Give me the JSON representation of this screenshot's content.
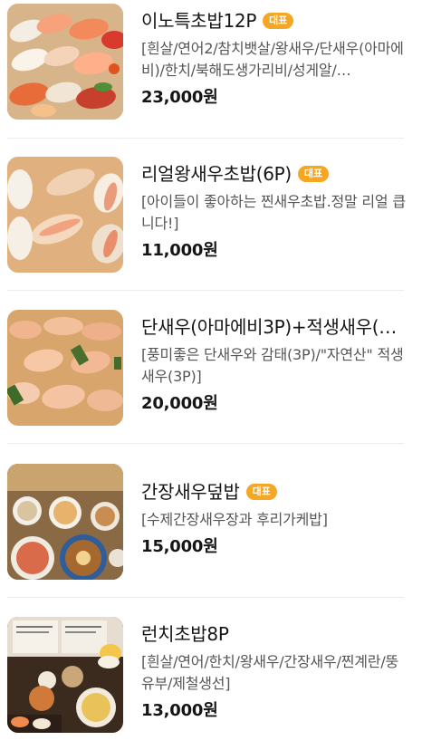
{
  "menu": {
    "items": [
      {
        "name": "이노특초밥12P",
        "badge": "대표",
        "description": "[흰살/연어2/참치뱃살/왕새우/단새우(아마에비)/한치/북해도생가리비/성게알/…",
        "price": "23,000원"
      },
      {
        "name": "리얼왕새우초밥(6P)",
        "badge": "대표",
        "description": "[아이들이 좋아하는 찐새우초밥.정말 리얼 큽니다!]",
        "price": "11,000원"
      },
      {
        "name": "단새우(아마에비3P)+적생새우(…",
        "badge": "",
        "description": "[풍미좋은 단새우와 감태(3P)/\"자연산\" 적생새우(3P)]",
        "price": "20,000원"
      },
      {
        "name": "간장새우덮밥",
        "badge": "대표",
        "description": "[수제간장새우장과 후리가케밥]",
        "price": "15,000원"
      },
      {
        "name": "런치초밥8P",
        "badge": "",
        "description": "[흰살/연어/한치/왕새우/간장새우/찐계란/뚱유부/제철생선]",
        "price": "13,000원"
      }
    ]
  },
  "icons": [
    "sushi-platter-photo",
    "shrimp-sushi-photo",
    "sweet-shrimp-sushi-photo",
    "shrimp-rice-bowl-photo",
    "lunch-set-photo"
  ]
}
